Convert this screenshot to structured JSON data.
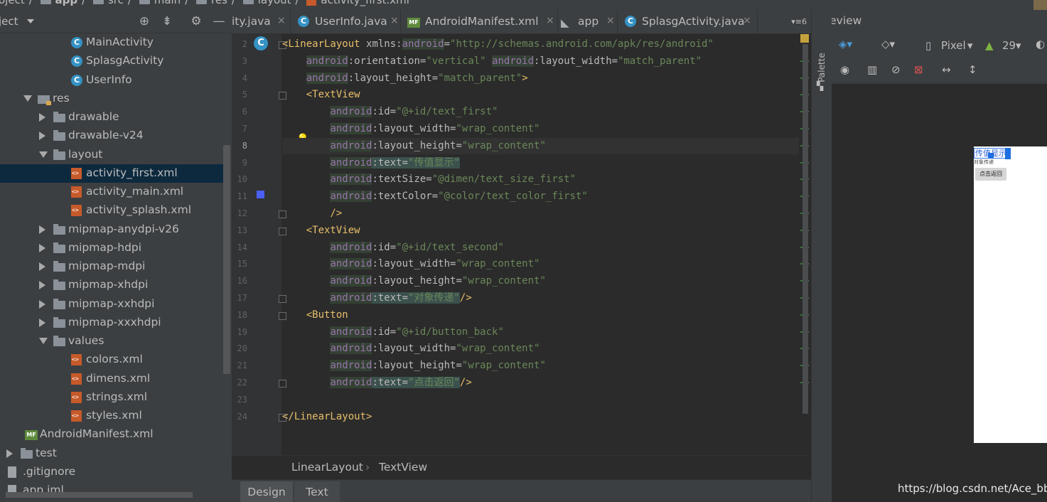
{
  "breadcrumb": {
    "items": [
      "oject",
      "app",
      "src",
      "main",
      "res",
      "layout",
      "activity_first.xml"
    ]
  },
  "project_panel": {
    "title": "ject",
    "tree": [
      {
        "label": "MainActivity",
        "icon": "class-icon"
      },
      {
        "label": "SplasgActivity",
        "icon": "class-icon"
      },
      {
        "label": "UserInfo",
        "icon": "class-icon"
      },
      {
        "label": "res",
        "icon": "res-folder-icon",
        "expanded": true
      },
      {
        "label": "drawable",
        "icon": "folder-icon",
        "expanded": false
      },
      {
        "label": "drawable-v24",
        "icon": "folder-icon",
        "expanded": false
      },
      {
        "label": "layout",
        "icon": "folder-icon",
        "expanded": true
      },
      {
        "label": "activity_first.xml",
        "icon": "xml-file-icon",
        "selected": true
      },
      {
        "label": "activity_main.xml",
        "icon": "xml-file-icon"
      },
      {
        "label": "activity_splash.xml",
        "icon": "xml-file-icon"
      },
      {
        "label": "mipmap-anydpi-v26",
        "icon": "folder-icon",
        "expanded": false
      },
      {
        "label": "mipmap-hdpi",
        "icon": "folder-icon",
        "expanded": false
      },
      {
        "label": "mipmap-mdpi",
        "icon": "folder-icon",
        "expanded": false
      },
      {
        "label": "mipmap-xhdpi",
        "icon": "folder-icon",
        "expanded": false
      },
      {
        "label": "mipmap-xxhdpi",
        "icon": "folder-icon",
        "expanded": false
      },
      {
        "label": "mipmap-xxxhdpi",
        "icon": "folder-icon",
        "expanded": false
      },
      {
        "label": "values",
        "icon": "folder-icon",
        "expanded": true
      },
      {
        "label": "colors.xml",
        "icon": "xml-file-icon"
      },
      {
        "label": "dimens.xml",
        "icon": "xml-file-icon"
      },
      {
        "label": "strings.xml",
        "icon": "xml-file-icon"
      },
      {
        "label": "styles.xml",
        "icon": "xml-file-icon"
      },
      {
        "label": "AndroidManifest.xml",
        "icon": "manifest-icon"
      },
      {
        "label": "test",
        "icon": "folder-icon",
        "expanded": false
      },
      {
        "label": ".gitignore",
        "icon": "file-icon"
      },
      {
        "label": "app.iml",
        "icon": "module-file-icon"
      }
    ]
  },
  "editor": {
    "tabs": [
      {
        "label": "ity.java",
        "close": "×"
      },
      {
        "label": "UserInfo.java",
        "close": "×"
      },
      {
        "label": "AndroidManifest.xml",
        "close": "×"
      },
      {
        "label": "app",
        "close": "×"
      },
      {
        "label": "SplasgActivity.java",
        "close": "×"
      }
    ],
    "tab_overflow": "▾≡6",
    "current_line": 8,
    "lines": [
      {
        "n": 2,
        "tokens": [
          [
            "tag",
            "<LinearLayout "
          ],
          [
            "attr",
            "xmlns:"
          ],
          [
            "ns",
            "android"
          ],
          [
            "attr",
            "="
          ],
          [
            "val",
            "\"http://schemas.android.com/apk/res/android\""
          ]
        ]
      },
      {
        "n": 3,
        "tokens": [
          [
            "plain",
            "    "
          ],
          [
            "ns",
            "android"
          ],
          [
            "attr",
            ":orientation="
          ],
          [
            "val",
            "\"vertical\" "
          ],
          [
            "ns",
            "android"
          ],
          [
            "attr",
            ":layout_width="
          ],
          [
            "val",
            "\"match_parent\""
          ]
        ]
      },
      {
        "n": 4,
        "tokens": [
          [
            "plain",
            "    "
          ],
          [
            "ns",
            "android"
          ],
          [
            "attr",
            ":layout_height="
          ],
          [
            "val",
            "\"match_parent\""
          ],
          [
            "tag",
            ">"
          ]
        ]
      },
      {
        "n": 5,
        "tokens": [
          [
            "plain",
            "    "
          ],
          [
            "tag",
            "<TextView"
          ]
        ]
      },
      {
        "n": 6,
        "tokens": [
          [
            "plain",
            "        "
          ],
          [
            "ns",
            "android"
          ],
          [
            "attr",
            ":id="
          ],
          [
            "val",
            "\"@+id/text_first\""
          ]
        ]
      },
      {
        "n": 7,
        "tokens": [
          [
            "plain",
            "        "
          ],
          [
            "ns",
            "android"
          ],
          [
            "attr",
            ":layout_width="
          ],
          [
            "val",
            "\"wrap_content\""
          ]
        ]
      },
      {
        "n": 8,
        "tokens": [
          [
            "plain",
            "        "
          ],
          [
            "ns",
            "android"
          ],
          [
            "attr",
            ":layout_height="
          ],
          [
            "val",
            "\"wrap_content\""
          ]
        ]
      },
      {
        "n": 9,
        "tokens": [
          [
            "plain",
            "        "
          ],
          [
            "ns",
            "android"
          ],
          [
            "hl",
            ":text="
          ],
          [
            "hlval",
            "\"传值显示\""
          ]
        ]
      },
      {
        "n": 10,
        "tokens": [
          [
            "plain",
            "        "
          ],
          [
            "ns",
            "android"
          ],
          [
            "attr",
            ":textSize="
          ],
          [
            "val",
            "\"@dimen/text_size_first\""
          ]
        ]
      },
      {
        "n": 11,
        "tokens": [
          [
            "plain",
            "        "
          ],
          [
            "ns",
            "android"
          ],
          [
            "attr",
            ":textColor="
          ],
          [
            "val",
            "\"@color/text_color_first\""
          ]
        ]
      },
      {
        "n": 12,
        "tokens": [
          [
            "plain",
            "        "
          ],
          [
            "tag",
            "/>"
          ]
        ]
      },
      {
        "n": 13,
        "tokens": [
          [
            "plain",
            "    "
          ],
          [
            "tag",
            "<TextView"
          ]
        ]
      },
      {
        "n": 14,
        "tokens": [
          [
            "plain",
            "        "
          ],
          [
            "ns",
            "android"
          ],
          [
            "attr",
            ":id="
          ],
          [
            "val",
            "\"@+id/text_second\""
          ]
        ]
      },
      {
        "n": 15,
        "tokens": [
          [
            "plain",
            "        "
          ],
          [
            "ns",
            "android"
          ],
          [
            "attr",
            ":layout_width="
          ],
          [
            "val",
            "\"wrap_content\""
          ]
        ]
      },
      {
        "n": 16,
        "tokens": [
          [
            "plain",
            "        "
          ],
          [
            "ns",
            "android"
          ],
          [
            "attr",
            ":layout_height="
          ],
          [
            "val",
            "\"wrap_content\""
          ]
        ]
      },
      {
        "n": 17,
        "tokens": [
          [
            "plain",
            "        "
          ],
          [
            "ns",
            "android"
          ],
          [
            "hl",
            ":text="
          ],
          [
            "hlval",
            "\"对象传递\""
          ],
          [
            "tag",
            "/>"
          ]
        ]
      },
      {
        "n": 18,
        "tokens": [
          [
            "plain",
            "    "
          ],
          [
            "tag",
            "<Button"
          ]
        ]
      },
      {
        "n": 19,
        "tokens": [
          [
            "plain",
            "        "
          ],
          [
            "ns",
            "android"
          ],
          [
            "attr",
            ":id="
          ],
          [
            "val",
            "\"@+id/button_back\""
          ]
        ]
      },
      {
        "n": 20,
        "tokens": [
          [
            "plain",
            "        "
          ],
          [
            "ns",
            "android"
          ],
          [
            "attr",
            ":layout_width="
          ],
          [
            "val",
            "\"wrap_content\""
          ]
        ]
      },
      {
        "n": 21,
        "tokens": [
          [
            "plain",
            "        "
          ],
          [
            "ns",
            "android"
          ],
          [
            "attr",
            ":layout_height="
          ],
          [
            "val",
            "\"wrap_content\""
          ]
        ]
      },
      {
        "n": 22,
        "tokens": [
          [
            "plain",
            "        "
          ],
          [
            "ns",
            "android"
          ],
          [
            "hl",
            ":text="
          ],
          [
            "hlval",
            "\"点击返回\""
          ],
          [
            "tag",
            "/>"
          ]
        ]
      },
      {
        "n": 23,
        "tokens": []
      },
      {
        "n": 24,
        "tokens": [
          [
            "tag",
            "</LinearLayout>"
          ]
        ]
      }
    ],
    "breadcrumb": [
      "LinearLayout",
      "TextView"
    ],
    "breadcrumb_sep": "›",
    "bottom_tabs": [
      "Design",
      "Text"
    ],
    "active_bottom_tab": "Text",
    "gutter_class_badge": "C"
  },
  "palette": {
    "label": "Palette"
  },
  "preview": {
    "title": "Preview",
    "device": "Pixel",
    "api": "29",
    "device_screen": {
      "text_first": "传值显示",
      "text_second": "对象传递",
      "button": "点击返回"
    }
  },
  "watermark": "https://blog.csdn.net/Ace_bb",
  "colors": {
    "editor_bg": "#2b2b2b",
    "panel_bg": "#3c3f41",
    "selection": "#0d293e",
    "tag": "#e8bf6a",
    "namespace": "#9876aa",
    "string": "#6a8759",
    "text_color_first_swatch": "#4b5ff0"
  }
}
